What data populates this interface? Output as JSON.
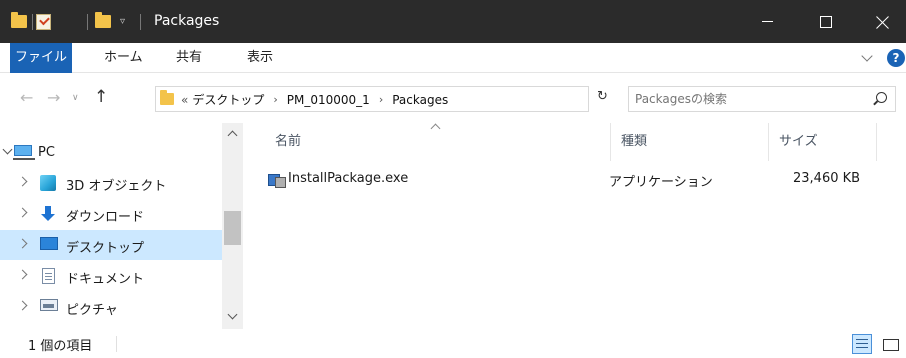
{
  "window": {
    "title": "Packages",
    "controls": [
      "minimize",
      "maximize",
      "close"
    ]
  },
  "quick_access": {
    "icons": [
      "folder-icon",
      "properties-icon",
      "new-folder-icon",
      "customize-dropdown-icon"
    ],
    "arrow": "▿"
  },
  "ribbon": {
    "file_tab": "ファイル",
    "home_tab": "ホーム",
    "share_tab": "共有",
    "view_tab": "表示",
    "help": "?"
  },
  "nav_buttons": {
    "back": "←",
    "forward": "→",
    "recent": "∨",
    "up": "↑"
  },
  "address": {
    "overflow": "«",
    "crumbs": [
      "デスクトップ",
      "PM_010000_1",
      "Packages"
    ],
    "separator": "›",
    "dropdown": "∨",
    "refresh": "↻"
  },
  "search": {
    "placeholder": "Packagesの検索"
  },
  "nav_pane": {
    "items": [
      {
        "label": "PC",
        "icon": "pc-icon",
        "expanded": true
      },
      {
        "label": "3D オブジェクト",
        "icon": "3d-objects-icon"
      },
      {
        "label": "ダウンロード",
        "icon": "downloads-icon"
      },
      {
        "label": "デスクトップ",
        "icon": "desktop-icon",
        "selected": true
      },
      {
        "label": "ドキュメント",
        "icon": "documents-icon"
      },
      {
        "label": "ピクチャ",
        "icon": "pictures-icon"
      }
    ]
  },
  "file_list": {
    "columns": {
      "name": "名前",
      "type": "種類",
      "size": "サイズ"
    },
    "rows": [
      {
        "name": "InstallPackage.exe",
        "type": "アプリケーション",
        "size": "23,460 KB",
        "icon": "exe-icon"
      }
    ]
  },
  "status": {
    "item_count": "1 個の項目"
  },
  "colors": {
    "titlebar": "#2b2b2b",
    "accent": "#1a63b5",
    "selection": "#cce8ff"
  }
}
